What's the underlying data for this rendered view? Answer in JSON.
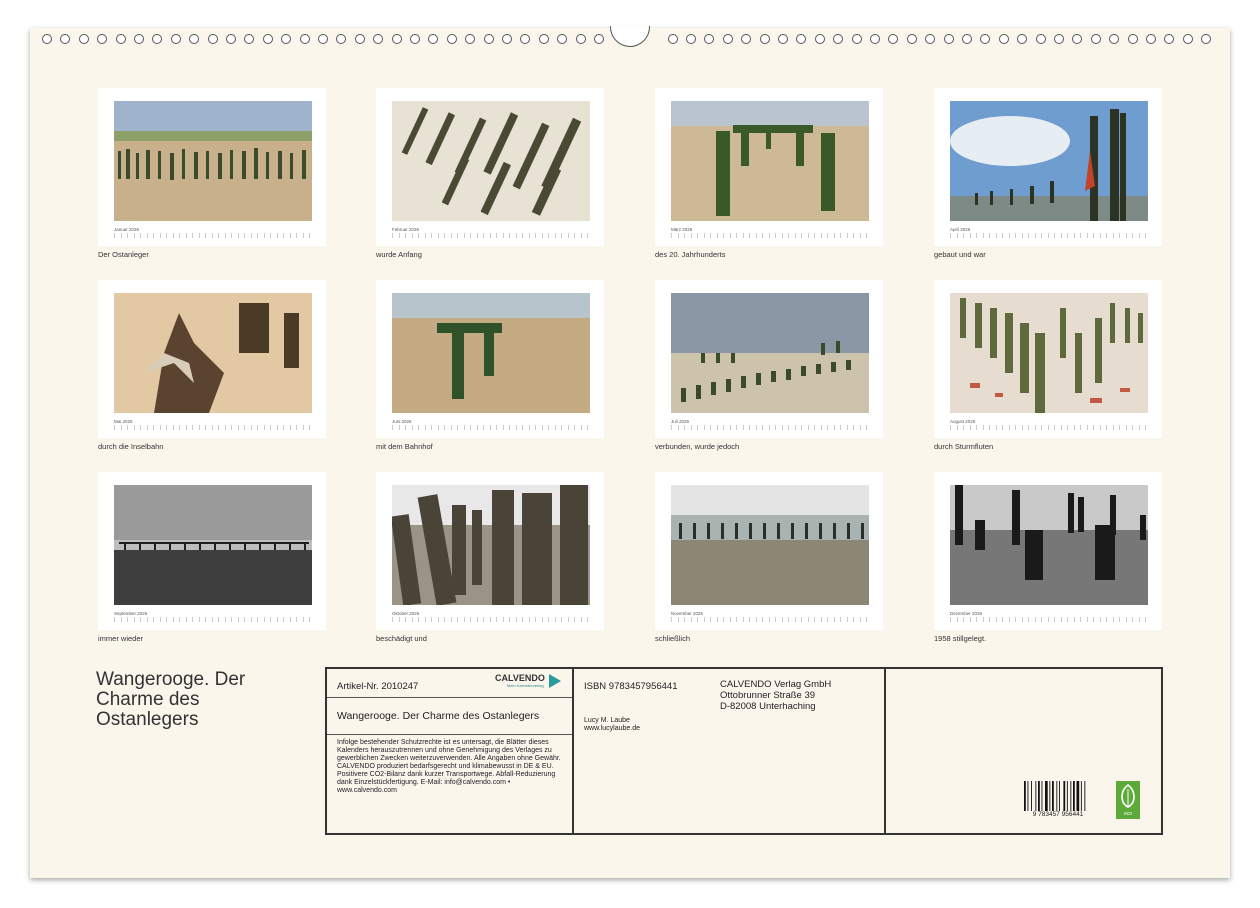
{
  "months": [
    {
      "name": "Januar 2026",
      "caption": "Der Ostanleger"
    },
    {
      "name": "Februar 2026",
      "caption": "wurde Anfang"
    },
    {
      "name": "März 2026",
      "caption": "des 20. Jahrhunderts"
    },
    {
      "name": "April 2026",
      "caption": "gebaut und war"
    },
    {
      "name": "Mai 2026",
      "caption": "durch die Inselbahn"
    },
    {
      "name": "Juni 2026",
      "caption": "mit dem Bahnhof"
    },
    {
      "name": "Juli 2026",
      "caption": "verbunden, wurde jedoch"
    },
    {
      "name": "August 2026",
      "caption": "durch Sturmfluten"
    },
    {
      "name": "September 2026",
      "caption": "immer wieder"
    },
    {
      "name": "Oktober 2026",
      "caption": "beschädigt und"
    },
    {
      "name": "November 2026",
      "caption": "schließlich"
    },
    {
      "name": "Dezember 2026",
      "caption": "1958 stillgelegt."
    }
  ],
  "title": "Wangerooge. Der Charme des Ostanlegers",
  "info": {
    "article": "Artikel-Nr. 2010247",
    "brand": "CALVENDO",
    "brand_sub": "Mein Kalenderverlag",
    "subtitle": "Wangerooge. Der Charme des Ostanlegers",
    "legal": "Infolge bestehender Schutzrechte ist es untersagt, die Blätter dieses Kalenders herauszutrennen und ohne Genehmigung des Verlages zu gewerblichen Zwecken weiterzuverwenden. Alle Angaben ohne Gewähr. CALVENDO produziert bedarfsgerecht und klimabewusst in DE & EU. Positivere CO2-Bilanz dank kurzer Transportwege. Abfall-Reduzierung dank Einzelstückfertigung. E-Mail: info@calvendo.com • www.calvendo.com",
    "isbn": "ISBN 9783457956441",
    "publisher_name": "CALVENDO Verlag GmbH",
    "publisher_street": "Ottobrunner Straße 39",
    "publisher_city": "D-82008 Unterhaching",
    "author": "Lucy M. Laube",
    "author_web": "www.lucylaube.de",
    "barcode_number": "9 783457 956441",
    "eco_label": "eco"
  },
  "colors": {
    "page": "#fbf6ec",
    "sand": "#c9b38f",
    "post": "#3f4a2c",
    "sky": "#a7bfd6"
  }
}
